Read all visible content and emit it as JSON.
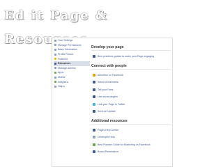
{
  "title": "Ed it Page & Resources",
  "sidebar": {
    "items": [
      {
        "label": "Your Settings",
        "icon": "gear-icon",
        "color": "#8b9dc3"
      },
      {
        "label": "Manage Permissions",
        "icon": "lock-icon",
        "color": "#8b9dc3"
      },
      {
        "label": "Basic Information",
        "icon": "info-icon",
        "color": "#8b9dc3"
      },
      {
        "label": "Profile Picture",
        "icon": "picture-icon",
        "color": "#8b9dc3"
      },
      {
        "label": "Featured",
        "icon": "star-icon",
        "color": "#e8b800"
      },
      {
        "label": "Resources",
        "icon": "book-icon",
        "color": "#3b5998"
      },
      {
        "label": "Manage Admins",
        "icon": "people-icon",
        "color": "#8b9dc3"
      },
      {
        "label": "Apps",
        "icon": "apps-icon",
        "color": "#6fa74b"
      },
      {
        "label": "Mobile",
        "icon": "phone-icon",
        "color": "#8b9dc3"
      },
      {
        "label": "Insights ▸",
        "icon": "chart-icon",
        "color": "#6fa74b"
      },
      {
        "label": "Help ▸",
        "icon": "help-icon",
        "color": "#8b9dc3"
      }
    ]
  },
  "sections": [
    {
      "title": "Develop your page",
      "rows": [
        {
          "label": "Best practices guides to make your Page engaging",
          "icon": "book-icon",
          "color": "#3b5998"
        }
      ]
    },
    {
      "title": "Connect with people",
      "rows": [
        {
          "label": "Advertise on Facebook",
          "icon": "megaphone-icon",
          "color": "#e8a000"
        },
        {
          "label": "Select a username",
          "icon": "user-icon",
          "color": "#3b5998"
        },
        {
          "label": "Tell your Fans",
          "icon": "people-icon",
          "color": "#3b5998"
        },
        {
          "label": "Use social plugins",
          "icon": "plugin-icon",
          "color": "#3b5998"
        },
        {
          "label": "Link your Page to Twitter",
          "icon": "twitter-icon",
          "color": "#4aaee0"
        },
        {
          "label": "Send an Update",
          "icon": "envelope-icon",
          "color": "#3b5998"
        }
      ]
    },
    {
      "title": "Additional resources",
      "rows": [
        {
          "label": "Pages Help Center",
          "icon": "lifebuoy-icon",
          "color": "#3b5998"
        },
        {
          "label": "Developer Help",
          "icon": "wrench-icon",
          "color": "#8b9dc3"
        },
        {
          "label": "Best Practice Guide for Marketing on Facebook",
          "icon": "checkmark-icon",
          "color": "#6fa74b"
        },
        {
          "label": "Brand Permissions",
          "icon": "badge-icon",
          "color": "#3b5998"
        }
      ]
    }
  ]
}
